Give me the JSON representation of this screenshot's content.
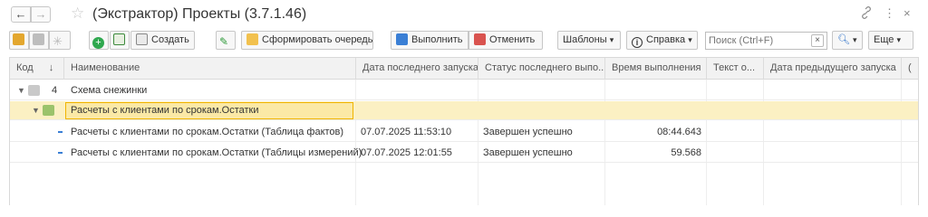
{
  "window": {
    "title": "(Экстрактор) Проекты (3.7.1.46)",
    "back_label": "←",
    "forward_label": "→",
    "star_icon": "☆",
    "link_icon": "🔗",
    "more_icon": "⋮",
    "close_icon": "×"
  },
  "toolbar": {
    "create_label": "Создать",
    "form_queue_label": "Сформировать очередь",
    "execute_label": "Выполнить",
    "cancel_label": "Отменить",
    "templates_label": "Шаблоны",
    "help_label": "Справка",
    "search_placeholder": "Поиск (Ctrl+F)",
    "search_clear": "×",
    "more_label": "Еще",
    "dropdown_arrow": "▾"
  },
  "table": {
    "columns": [
      "Код",
      "Наименование",
      "Дата последнего запуска",
      "Статус последнего выпо...",
      "Время выполнения",
      "Текст о...",
      "Дата предыдущего запуска",
      "("
    ],
    "sort_arrow": "↓",
    "rows": [
      {
        "code": "4",
        "name": "Схема снежинки",
        "date": "",
        "status": "",
        "duration": "",
        "text": "",
        "prev_date": ""
      },
      {
        "code": "",
        "name": "Расчеты с клиентами по срокам.Остатки",
        "date": "",
        "status": "",
        "duration": "",
        "text": "",
        "prev_date": ""
      },
      {
        "code": "",
        "name": "Расчеты с клиентами по срокам.Остатки (Таблица фактов)",
        "date": "07.07.2025 11:53:10",
        "status": "Завершен успешно",
        "duration": "08:44.643",
        "text": "",
        "prev_date": ""
      },
      {
        "code": "",
        "name": "Расчеты с клиентами по срокам.Остатки (Таблицы измерений)",
        "date": "07.07.2025 12:01:55",
        "status": "Завершен успешно",
        "duration": "59.568",
        "text": "",
        "prev_date": ""
      }
    ]
  },
  "colors": {
    "selected_row": "#fbf0c3",
    "focus_border": "#f0b400",
    "accent_yellow": "#f5c518",
    "green": "#2fa84f",
    "blue": "#3a7fd5"
  }
}
